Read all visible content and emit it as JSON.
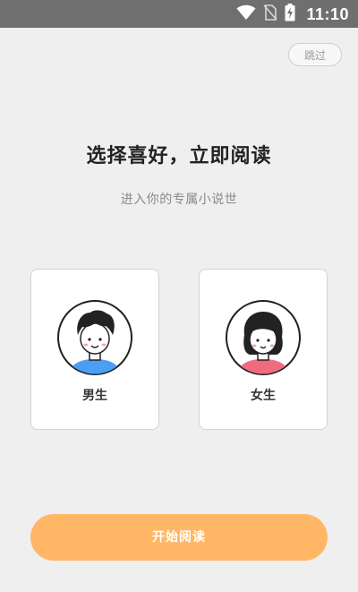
{
  "status_bar": {
    "time": "11:10",
    "icons": [
      "wifi-icon",
      "no-sim-icon",
      "battery-charging-icon"
    ]
  },
  "header": {
    "skip_label": "跳过"
  },
  "main": {
    "title": "选择喜好，立即阅读",
    "subtitle": "进入你的专属小说世"
  },
  "gender_options": [
    {
      "label": "男生",
      "icon": "boy-avatar-icon"
    },
    {
      "label": "女生",
      "icon": "girl-avatar-icon"
    }
  ],
  "footer": {
    "start_label": "开始阅读"
  },
  "colors": {
    "accent": "#ffb766",
    "background": "#efefef",
    "status_bar": "#6f6f6f",
    "boy_shirt": "#4a9ff5",
    "girl_shirt": "#f06b7d"
  }
}
